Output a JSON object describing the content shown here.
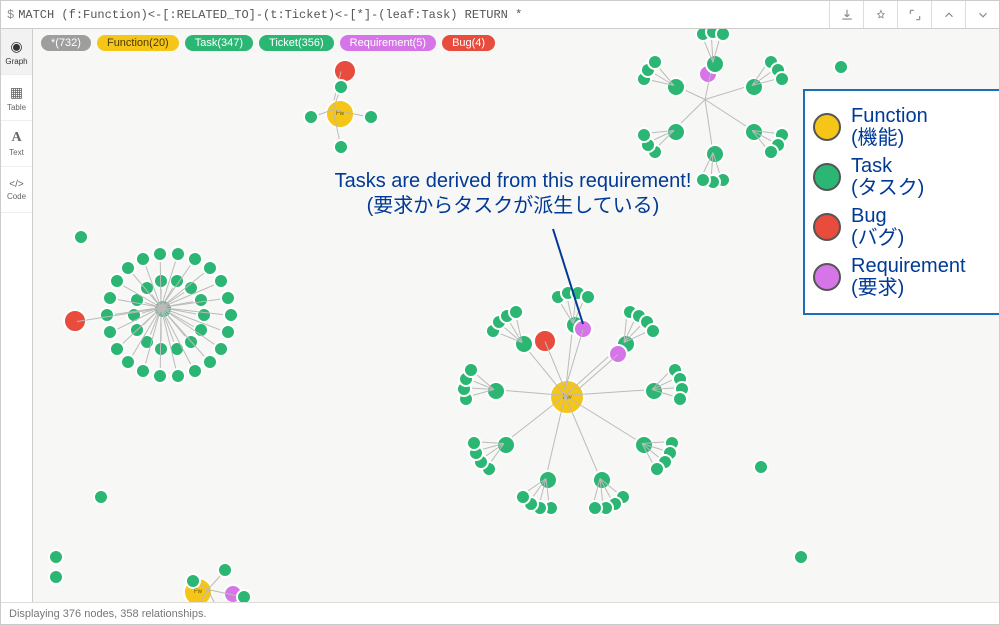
{
  "query": {
    "prompt": "$",
    "text": "MATCH (f:Function)<-[:RELATED_TO]-(t:Ticket)<-[*]-(leaf:Task) RETURN *"
  },
  "toolbar_icons": [
    "download-icon",
    "pin-icon",
    "expand-icon",
    "collapse-up-icon",
    "collapse-down-icon"
  ],
  "sidebar": {
    "items": [
      {
        "id": "graph",
        "label": "Graph",
        "icon": "◉"
      },
      {
        "id": "table",
        "label": "Table",
        "icon": "▦"
      },
      {
        "id": "text",
        "label": "Text",
        "icon": "A"
      },
      {
        "id": "code",
        "label": "Code",
        "icon": "</>"
      }
    ],
    "active": "graph"
  },
  "legend_pills": [
    {
      "cls": "star",
      "label": "*(732)"
    },
    {
      "cls": "function",
      "label": "Function(20)"
    },
    {
      "cls": "task",
      "label": "Task(347)"
    },
    {
      "cls": "ticket",
      "label": "Ticket(356)"
    },
    {
      "cls": "requirement",
      "label": "Requirement(5)"
    },
    {
      "cls": "bug",
      "label": "Bug(4)"
    }
  ],
  "annotation": {
    "line1": "Tasks are derived from this requirement!",
    "line2": "(要求からタスクが派生している)"
  },
  "legend_box": [
    {
      "color": "#f5c518",
      "en": "Function",
      "jp": "(機能)"
    },
    {
      "color": "#2cb673",
      "en": "Task",
      "jp": "(タスク)"
    },
    {
      "color": "#e74c3c",
      "en": "Bug",
      "jp": "(バグ)"
    },
    {
      "color": "#d675e8",
      "en": "Requirement",
      "jp": "(要求)"
    }
  ],
  "footer": "Displaying 376 nodes, 358 relationships.",
  "node_label_func": "Fw"
}
